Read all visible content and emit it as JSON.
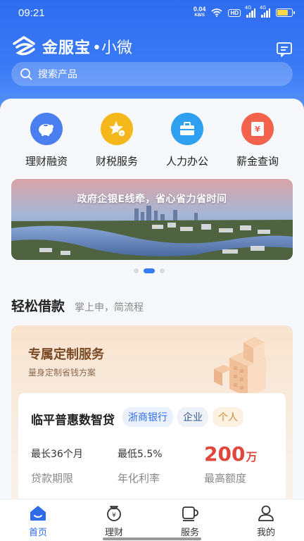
{
  "status_bar": {
    "time": "09:21",
    "net_speed_value": "0.04",
    "net_speed_unit": "KB/S",
    "hd_label": "HD",
    "signal_tech": "4G",
    "battery_level": 0.8
  },
  "brand": {
    "name": "金服宝",
    "sub": "•小微"
  },
  "search": {
    "placeholder": "搜索产品"
  },
  "quick_menu": [
    {
      "label": "理财融资",
      "icon": "piggy-bank-icon",
      "color": "#4a7ff0"
    },
    {
      "label": "财税服务",
      "icon": "tax-star-icon",
      "color": "#f5b81c"
    },
    {
      "label": "人力办公",
      "icon": "briefcase-icon",
      "color": "#2f9ff0"
    },
    {
      "label": "薪金查询",
      "icon": "salary-icon",
      "color": "#f2624d"
    }
  ],
  "banner": {
    "text": "政府企银E线牵，省心省力省时间"
  },
  "carousel": {
    "count": 3,
    "active": 1
  },
  "section": {
    "title": "轻松借款",
    "subtitle": "掌上申，简流程"
  },
  "loan_card": {
    "title": "专属定制服务",
    "subtitle": "量身定制省钱方案",
    "product": {
      "name": "临平普惠数智贷",
      "tags": [
        "浙商银行",
        "企业",
        "个人"
      ],
      "term_value": "最长36个月",
      "term_label": "贷款期限",
      "rate_value": "最低5.5%",
      "rate_label": "年化利率",
      "limit_value": "200",
      "limit_unit": "万",
      "limit_label": "最高额度"
    }
  },
  "tabbar": [
    {
      "label": "首页",
      "icon": "home-icon",
      "active": true
    },
    {
      "label": "理财",
      "icon": "money-bag-icon",
      "active": false
    },
    {
      "label": "服务",
      "icon": "cup-icon",
      "active": false
    },
    {
      "label": "我的",
      "icon": "user-icon",
      "active": false
    }
  ],
  "colors": {
    "primary": "#2f6de8",
    "accent_red": "#e0473c"
  }
}
